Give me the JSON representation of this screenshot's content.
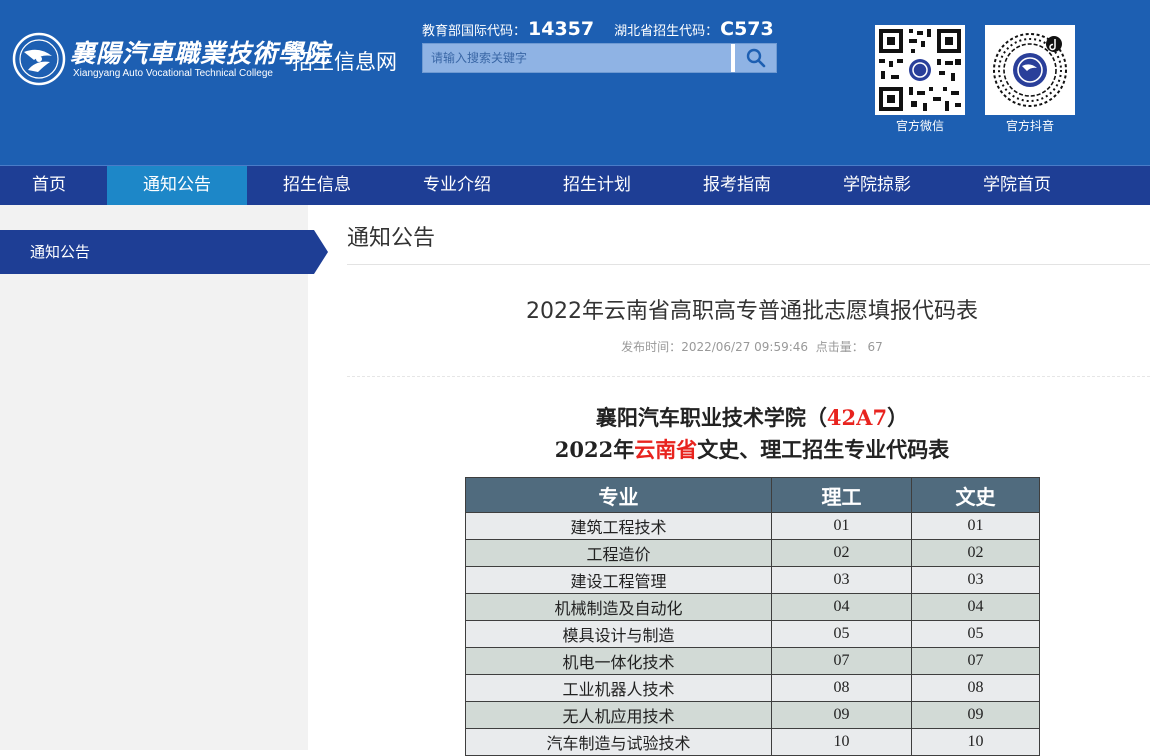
{
  "header": {
    "logo_cn": "襄陽汽車職業技術學院",
    "logo_en": "Xiangyang Auto Vocational Technical College",
    "site_name": "招生信息网",
    "moe_code_label": "教育部国际代码：",
    "moe_code": "14357",
    "hubei_code_label": "湖北省招生代码：",
    "hubei_code": "C573",
    "search_placeholder": "请输入搜索关键字",
    "wechat_label": "官方微信",
    "douyin_label": "官方抖音",
    "colors": {
      "header_bg": "#1d5fb2",
      "nav_bg": "#1e3e95",
      "nav_active": "#1d87c8"
    },
    "icons": [
      "logo-emblem-icon",
      "search-icon",
      "wechat-qr-icon",
      "douyin-qr-icon"
    ]
  },
  "nav": {
    "items": [
      {
        "label": "首页"
      },
      {
        "label": "通知公告"
      },
      {
        "label": "招生信息"
      },
      {
        "label": "专业介绍"
      },
      {
        "label": "招生计划"
      },
      {
        "label": "报考指南"
      },
      {
        "label": "学院掠影"
      },
      {
        "label": "学院首页"
      }
    ],
    "active_index": 1
  },
  "sidebar": {
    "active_label": "通知公告"
  },
  "main": {
    "section_title": "通知公告",
    "article_title": "2022年云南省高职高专普通批志愿填报代码表",
    "meta_time_label": "发布时间：",
    "meta_time": "2022/06/27 09:59:46",
    "meta_hits_label": "点击量：",
    "meta_hits": "67"
  },
  "document": {
    "line1_prefix": "襄阳汽车职业技术学院（",
    "line1_code": "42A7",
    "line1_suffix": "）",
    "line2_prefix": "2022年",
    "line2_province": "云南省",
    "line2_suffix": "文史、理工招生专业代码表"
  },
  "table": {
    "headers": [
      "专业",
      "理工",
      "文史"
    ],
    "rows": [
      [
        "建筑工程技术",
        "01",
        "01"
      ],
      [
        "工程造价",
        "02",
        "02"
      ],
      [
        "建设工程管理",
        "03",
        "03"
      ],
      [
        "机械制造及自动化",
        "04",
        "04"
      ],
      [
        "模具设计与制造",
        "05",
        "05"
      ],
      [
        "机电一体化技术",
        "07",
        "07"
      ],
      [
        "工业机器人技术",
        "08",
        "08"
      ],
      [
        "无人机应用技术",
        "09",
        "09"
      ],
      [
        "汽车制造与试验技术",
        "10",
        "10"
      ]
    ]
  }
}
